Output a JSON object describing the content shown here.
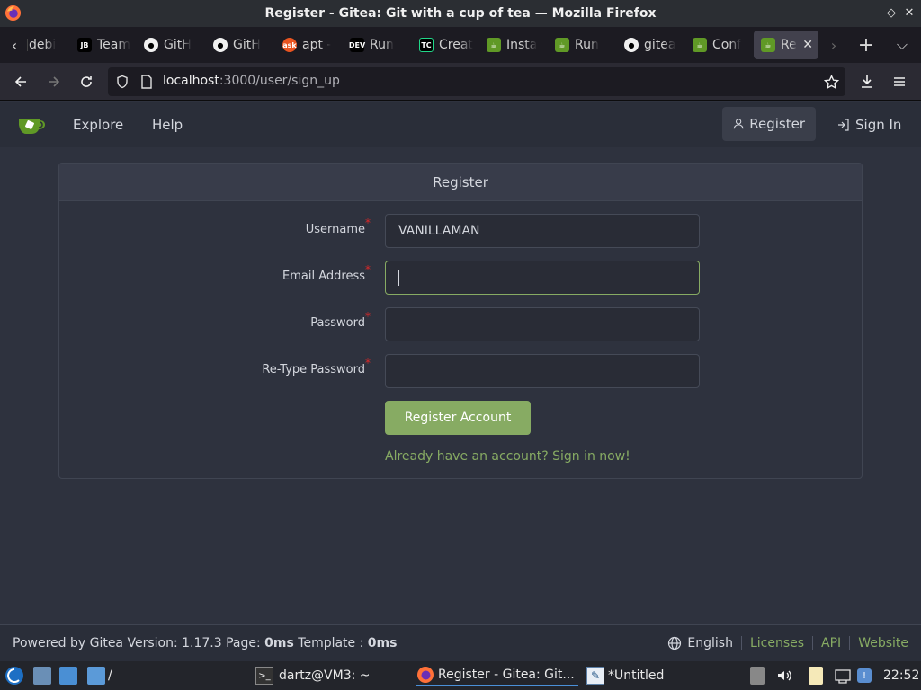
{
  "window": {
    "title": "Register - Gitea: Git with a cup of tea — Mozilla Firefox"
  },
  "tabs": [
    {
      "label": "debi",
      "icon": "debian-icon"
    },
    {
      "label": "Team",
      "icon": "jetbrains-icon"
    },
    {
      "label": "GitH",
      "icon": "github-icon"
    },
    {
      "label": "GitH",
      "icon": "github-icon"
    },
    {
      "label": "apt -",
      "icon": "askubuntu-icon"
    },
    {
      "label": "Run",
      "icon": "dev-icon"
    },
    {
      "label": "Creat",
      "icon": "teamcity-icon"
    },
    {
      "label": "Insta",
      "icon": "gitea-icon"
    },
    {
      "label": "Run",
      "icon": "gitea-icon"
    },
    {
      "label": "gitea",
      "icon": "github-icon"
    },
    {
      "label": "Conf",
      "icon": "gitea-icon"
    },
    {
      "label": "Re",
      "icon": "gitea-icon",
      "active": true
    }
  ],
  "navbar": {
    "url_host": "localhost",
    "url_path": ":3000/user/sign_up"
  },
  "gitea_nav": {
    "explore": "Explore",
    "help": "Help",
    "register": "Register",
    "sign_in": "Sign In"
  },
  "form": {
    "heading": "Register",
    "username_label": "Username",
    "username_value": "VANILLAMAN",
    "email_label": "Email Address",
    "email_value": "",
    "password_label": "Password",
    "retype_label": "Re-Type Password",
    "required_mark": "*",
    "submit_label": "Register Account",
    "signin_link": "Already have an account? Sign in now!"
  },
  "footer": {
    "powered_prefix": "Powered by Gitea Version: 1.17.3 Page: ",
    "page_time": "0ms",
    "template_prefix": " Template : ",
    "template_time": "0ms",
    "language": "English",
    "licenses": "Licenses",
    "api": "API",
    "website": "Website"
  },
  "taskbar": {
    "path_label": "/",
    "terminal": "dartz@VM3: ~",
    "firefox": "Register - Gitea: Git...",
    "editor": "*Untitled",
    "clock": "22:52"
  },
  "colors": {
    "gitea_green": "#87ab63",
    "page_bg": "#2e323e",
    "required_red": "#db2828"
  }
}
